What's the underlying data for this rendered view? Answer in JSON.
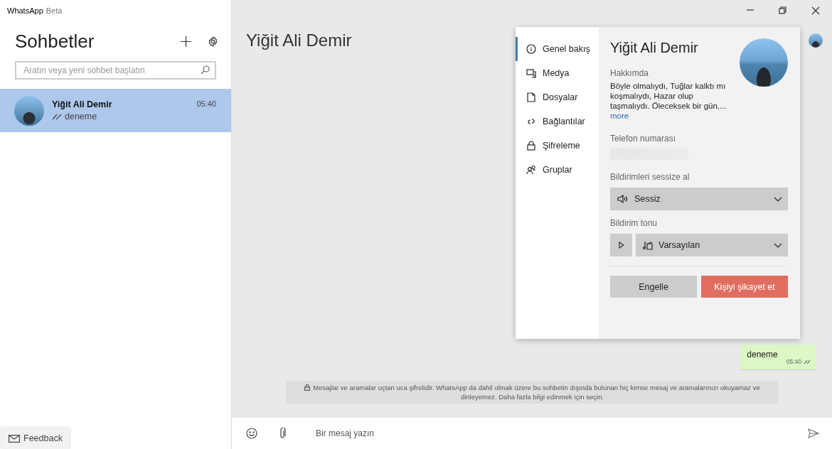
{
  "window": {
    "title": "WhatsApp",
    "subtitle": "Beta"
  },
  "sidebar": {
    "title": "Sohbetler",
    "search": {
      "placeholder": "Aratın veya yeni sohbet başlatın"
    },
    "chats": [
      {
        "name": "Yiğit Ali Demir",
        "time": "05:40",
        "preview": "deneme",
        "selected": true
      }
    ],
    "feedback": "Feedback"
  },
  "chat": {
    "title": "Yiğit Ali Demir",
    "messages": [
      {
        "text": "deneme",
        "time": "05:40",
        "outgoing": true
      }
    ],
    "notice": "Mesajlar ve aramalar uçtan uca şifrelidir. WhatsApp da dahil olmak üzere bu sohbetin dışında bulunan hiç kimse mesaj ve aramalarınızı okuyamaz ve dinleyemez. Daha fazla bilgi edinmek için seçin.",
    "composer": {
      "placeholder": "Bir mesaj yazın"
    }
  },
  "contact_panel": {
    "nav": [
      {
        "label": "Genel bakış",
        "selected": true
      },
      {
        "label": "Medya",
        "selected": false
      },
      {
        "label": "Dosyalar",
        "selected": false
      },
      {
        "label": "Bağlantılar",
        "selected": false
      },
      {
        "label": "Şifreleme",
        "selected": false
      },
      {
        "label": "Gruplar",
        "selected": false
      }
    ],
    "name": "Yiğit Ali Demir",
    "about_label": "Hakkımda",
    "about": "Böyle olmalıydı, Tuğlar kalktı mı koşmalıydı, Hazar olup taşmalıydı. Öleceksek bir gün,...",
    "more": "more",
    "phone_label": "Telefon numarası",
    "mute_label": "Bildirimleri sessize al",
    "mute_value": "Sessiz",
    "tone_label": "Bildirim tonu",
    "tone_value": "Varsayılan",
    "buttons": [
      {
        "label": "Engelle",
        "kind": "neutral"
      },
      {
        "label": "Kişiyi şikayet et",
        "kind": "danger"
      }
    ]
  }
}
